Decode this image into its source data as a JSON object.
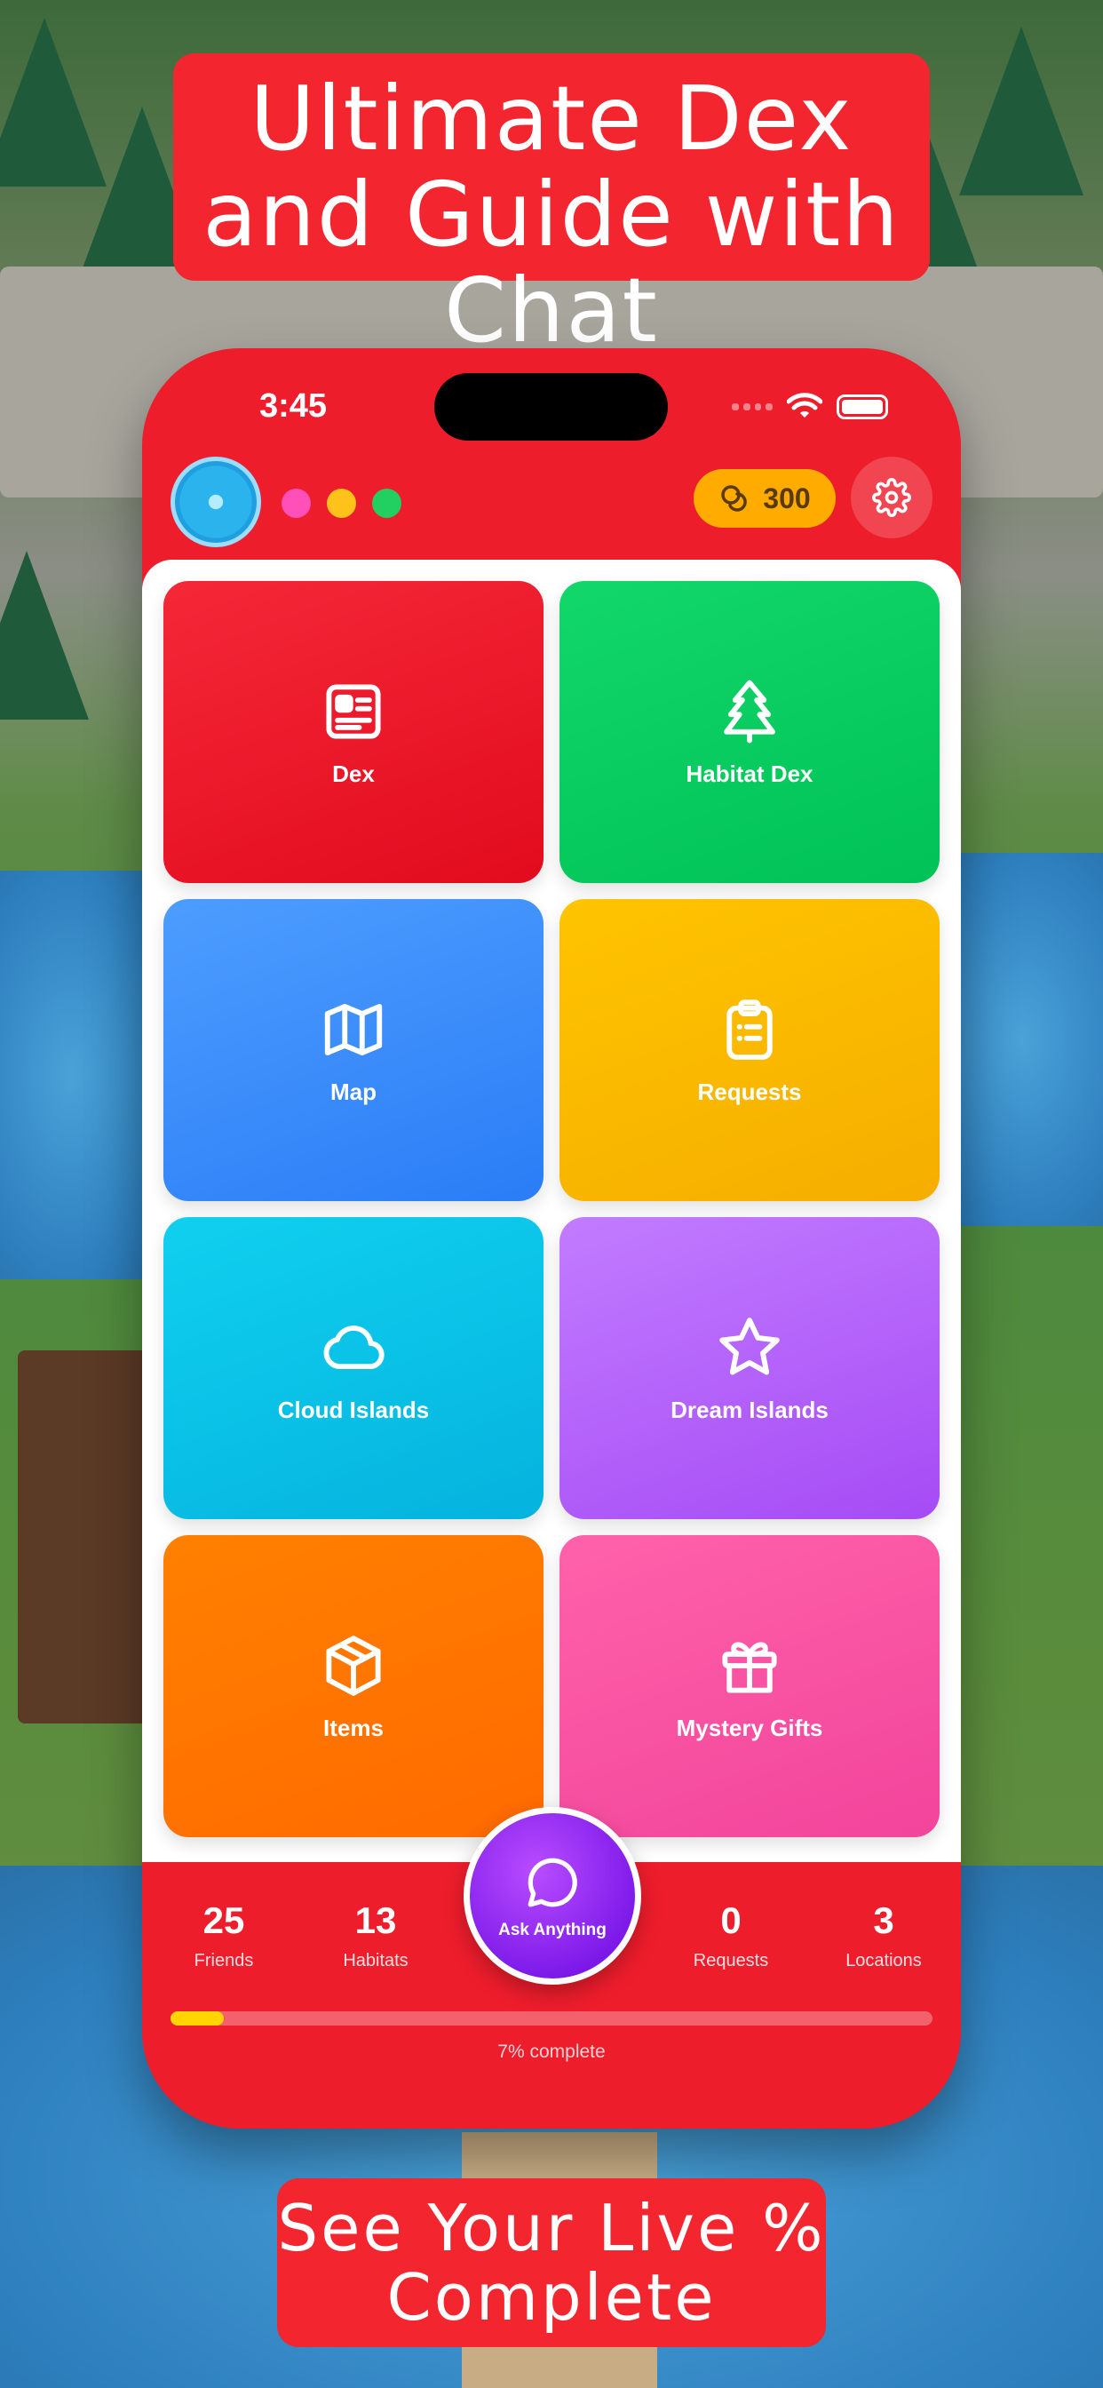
{
  "banners": {
    "top": "Ultimate Dex and Guide with Chat",
    "bottom": "See Your Live % Complete"
  },
  "status_bar": {
    "time": "3:45"
  },
  "header": {
    "coins": "300",
    "dot_colors": [
      "#ff4fb8",
      "#ffc21a",
      "#21d060"
    ]
  },
  "tiles": [
    {
      "label": "Dex",
      "icon": "id-card-icon",
      "color_start": "#f52838",
      "color_end": "#e20b1e"
    },
    {
      "label": "Habitat Dex",
      "icon": "tree-icon",
      "color_start": "#12d76a",
      "color_end": "#00c257"
    },
    {
      "label": "Map",
      "icon": "map-icon",
      "color_start": "#4d9dff",
      "color_end": "#2b7df6"
    },
    {
      "label": "Requests",
      "icon": "clipboard-icon",
      "color_start": "#ffc400",
      "color_end": "#f5ae00"
    },
    {
      "label": "Cloud Islands",
      "icon": "cloud-icon",
      "color_start": "#10d0ef",
      "color_end": "#05b3de"
    },
    {
      "label": "Dream Islands",
      "icon": "star-icon",
      "color_start": "#c27cff",
      "color_end": "#a64bf5"
    },
    {
      "label": "Items",
      "icon": "box-icon",
      "color_start": "#ff8000",
      "color_end": "#ff6a00"
    },
    {
      "label": "Mystery Gifts",
      "icon": "gift-icon",
      "color_start": "#ff62aa",
      "color_end": "#f2449b"
    }
  ],
  "stats": {
    "friends": {
      "value": "25",
      "label": "Friends"
    },
    "habitats": {
      "value": "13",
      "label": "Habitats"
    },
    "requests": {
      "value": "0",
      "label": "Requests"
    },
    "locations": {
      "value": "3",
      "label": "Locations"
    }
  },
  "ask_button": {
    "label": "Ask Anything",
    "icon": "chat-bubble-icon"
  },
  "progress": {
    "fraction": 0.07,
    "label": "7% complete"
  },
  "colors": {
    "phone_red": "#ee1d2c",
    "banner_red": "#f3262f",
    "progress_fill": "#ffd400",
    "coin_pill": "#ffab00"
  }
}
